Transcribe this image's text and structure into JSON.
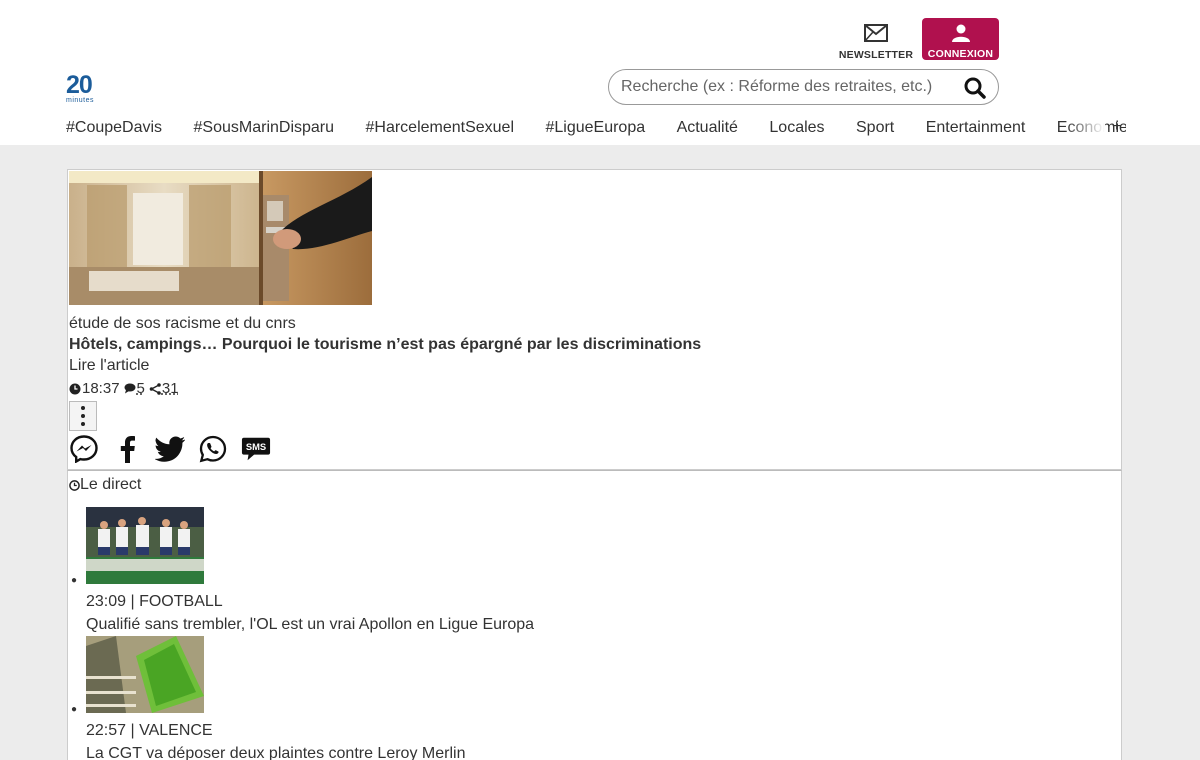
{
  "brand": {
    "logo_number": "20",
    "logo_sub": "minutes"
  },
  "header": {
    "newsletter_label": "NEWSLETTER",
    "login_label": "CONNEXION",
    "search_placeholder": "Recherche (ex : Réforme des retraites, etc.)",
    "accent_color": "#b0114e"
  },
  "nav": {
    "items": [
      "#CoupeDavis",
      "#SousMarinDisparu",
      "#HarcelementSexuel",
      "#LigueEuropa",
      "Actualité",
      "Locales",
      "Sport",
      "Entertainment",
      "Economie"
    ],
    "more_label": "+"
  },
  "featured": {
    "kicker": "étude de sos racisme et du cnrs",
    "title": "Hôtels, campings… Pourquoi le tourisme n’est pas épargné par les discriminations",
    "read_label": "Lire l'article",
    "time": "18:37",
    "comments": "5",
    "shares": "31",
    "share_icons": [
      "messenger-icon",
      "facebook-icon",
      "twitter-icon",
      "whatsapp-icon",
      "sms-icon"
    ]
  },
  "live": {
    "heading": "Le direct",
    "items": [
      {
        "meta": "23:09 | FOOTBALL",
        "title": "Qualifié sans trembler, l'OL est un vrai Apollon en Ligue Europa"
      },
      {
        "meta": "22:57 | VALENCE",
        "title": "La CGT va déposer deux plaintes contre Leroy Merlin"
      }
    ]
  }
}
